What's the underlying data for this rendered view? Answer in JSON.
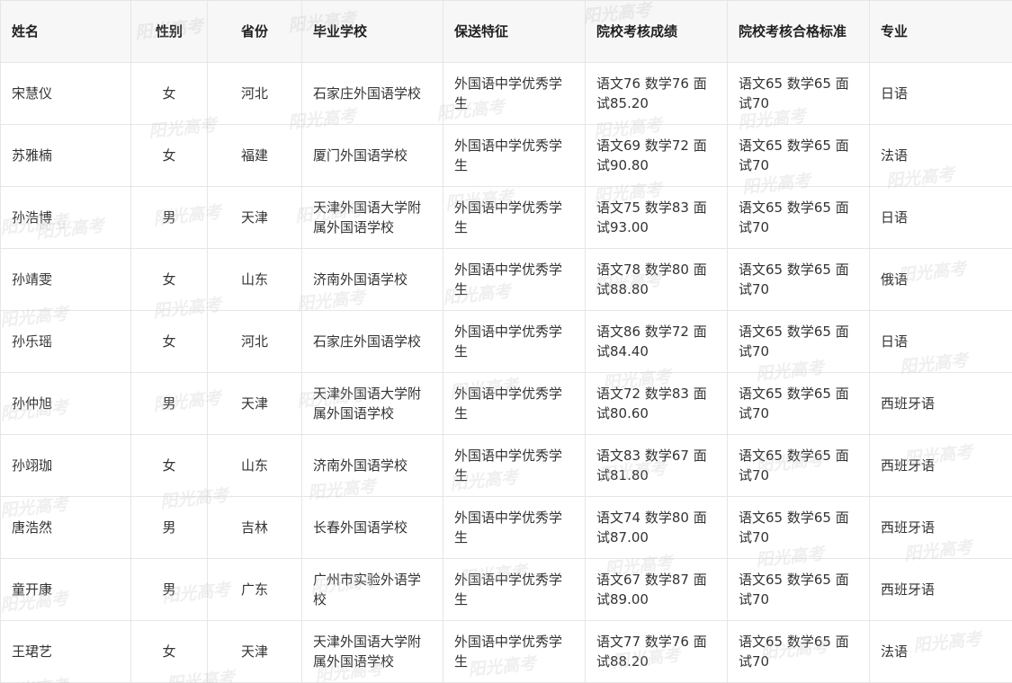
{
  "watermark": "阳光高考",
  "headers": {
    "name": "姓名",
    "gender": "性别",
    "province": "省份",
    "school": "毕业学校",
    "feature": "保送特征",
    "score": "院校考核成绩",
    "standard": "院校考核合格标准",
    "major": "专业"
  },
  "rows": [
    {
      "name": "宋慧仪",
      "gender": "女",
      "province": "河北",
      "school": "石家庄外国语学校",
      "feature": "外国语中学优秀学生",
      "score": "语文76 数学76 面试85.20",
      "standard": "语文65 数学65 面试70",
      "major": "日语"
    },
    {
      "name": "苏雅楠",
      "gender": "女",
      "province": "福建",
      "school": "厦门外国语学校",
      "feature": "外国语中学优秀学生",
      "score": "语文69 数学72 面试90.80",
      "standard": "语文65 数学65 面试70",
      "major": "法语"
    },
    {
      "name": "孙浩博",
      "gender": "男",
      "province": "天津",
      "school": "天津外国语大学附属外国语学校",
      "feature": "外国语中学优秀学生",
      "score": "语文75 数学83 面试93.00",
      "standard": "语文65 数学65 面试70",
      "major": "日语"
    },
    {
      "name": "孙靖雯",
      "gender": "女",
      "province": "山东",
      "school": "济南外国语学校",
      "feature": "外国语中学优秀学生",
      "score": "语文78 数学80 面试88.80",
      "standard": "语文65 数学65 面试70",
      "major": "俄语"
    },
    {
      "name": "孙乐瑶",
      "gender": "女",
      "province": "河北",
      "school": "石家庄外国语学校",
      "feature": "外国语中学优秀学生",
      "score": "语文86 数学72 面试84.40",
      "standard": "语文65 数学65 面试70",
      "major": "日语"
    },
    {
      "name": "孙仲旭",
      "gender": "男",
      "province": "天津",
      "school": "天津外国语大学附属外国语学校",
      "feature": "外国语中学优秀学生",
      "score": "语文72 数学83 面试80.60",
      "standard": "语文65 数学65 面试70",
      "major": "西班牙语"
    },
    {
      "name": "孙翊珈",
      "gender": "女",
      "province": "山东",
      "school": "济南外国语学校",
      "feature": "外国语中学优秀学生",
      "score": "语文83 数学67 面试81.80",
      "standard": "语文65 数学65 面试70",
      "major": "西班牙语"
    },
    {
      "name": "唐浩然",
      "gender": "男",
      "province": "吉林",
      "school": "长春外国语学校",
      "feature": "外国语中学优秀学生",
      "score": "语文74 数学80 面试87.00",
      "standard": "语文65 数学65 面试70",
      "major": "西班牙语"
    },
    {
      "name": "童开康",
      "gender": "男",
      "province": "广东",
      "school": "广州市实验外语学校",
      "feature": "外国语中学优秀学生",
      "score": "语文67 数学87 面试89.00",
      "standard": "语文65 数学65 面试70",
      "major": "西班牙语"
    },
    {
      "name": "王珺艺",
      "gender": "女",
      "province": "天津",
      "school": "天津外国语大学附属外国语学校",
      "feature": "外国语中学优秀学生",
      "score": "语文77 数学76 面试88.20",
      "standard": "语文65 数学65 面试70",
      "major": "法语"
    }
  ]
}
